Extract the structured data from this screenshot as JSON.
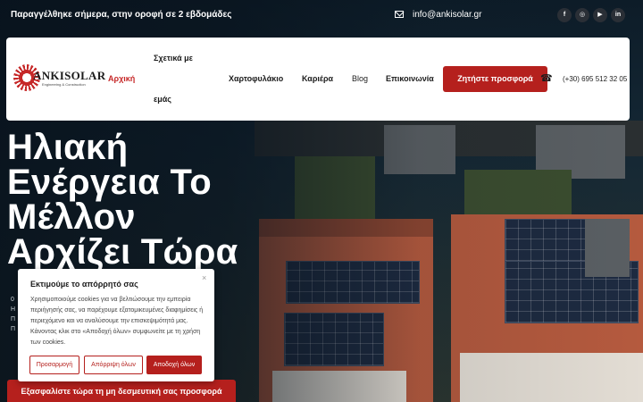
{
  "topbar": {
    "announcement": "Παραγγέλθηκε σήμερα, στην οροφή σε 2 εβδομάδες",
    "email": "info@ankisolar.gr",
    "social": [
      {
        "name": "facebook-icon",
        "glyph": "f"
      },
      {
        "name": "instagram-icon",
        "glyph": "◎"
      },
      {
        "name": "youtube-icon",
        "glyph": "▶"
      },
      {
        "name": "linkedin-icon",
        "glyph": "in"
      }
    ]
  },
  "logo": {
    "text": "ANKISOLAR",
    "subtext": "Engineering & Construction"
  },
  "nav": {
    "home": "Αρχική",
    "about_line1": "Σχετικά με",
    "about_line2": "εμάς",
    "portfolio": "Χαρτοφυλάκιο",
    "careers": "Καριέρα",
    "blog": "Blog",
    "contact": "Επικοινωνία",
    "cta": "Ζητήστε προσφορά",
    "phone": "(+30) 695 512 32 05"
  },
  "hero": {
    "headline_lines": [
      "Ηλιακή",
      "Ενέργεια Το",
      "Μέλλον",
      "Αρχίζει Τώρα"
    ],
    "partial_lines": [
      "0",
      "Η",
      "Π",
      "Π"
    ],
    "cta": "Εξασφαλίστε τώρα τη μη δεσμευτική σας προσφορά"
  },
  "cookie": {
    "title": "Εκτιμούμε το απόρρητό σας",
    "body": "Χρησιμοποιούμε cookies για να βελτιώσουμε την εμπειρία περιήγησής σας, να παρέχουμε εξατομικευμένες διαφημίσεις ή περιεχόμενο και να αναλύσουμε την επισκεψιμότητά μας. Κάνοντας κλικ στο «Αποδοχή όλων» συμφωνείτε με τη χρήση των cookies.",
    "customize": "Προσαρμογή",
    "reject": "Απόρριψη όλων",
    "accept": "Αποδοχή όλων",
    "close": "×"
  },
  "colors": {
    "accent": "#b5201d",
    "active_nav": "#c62828"
  }
}
